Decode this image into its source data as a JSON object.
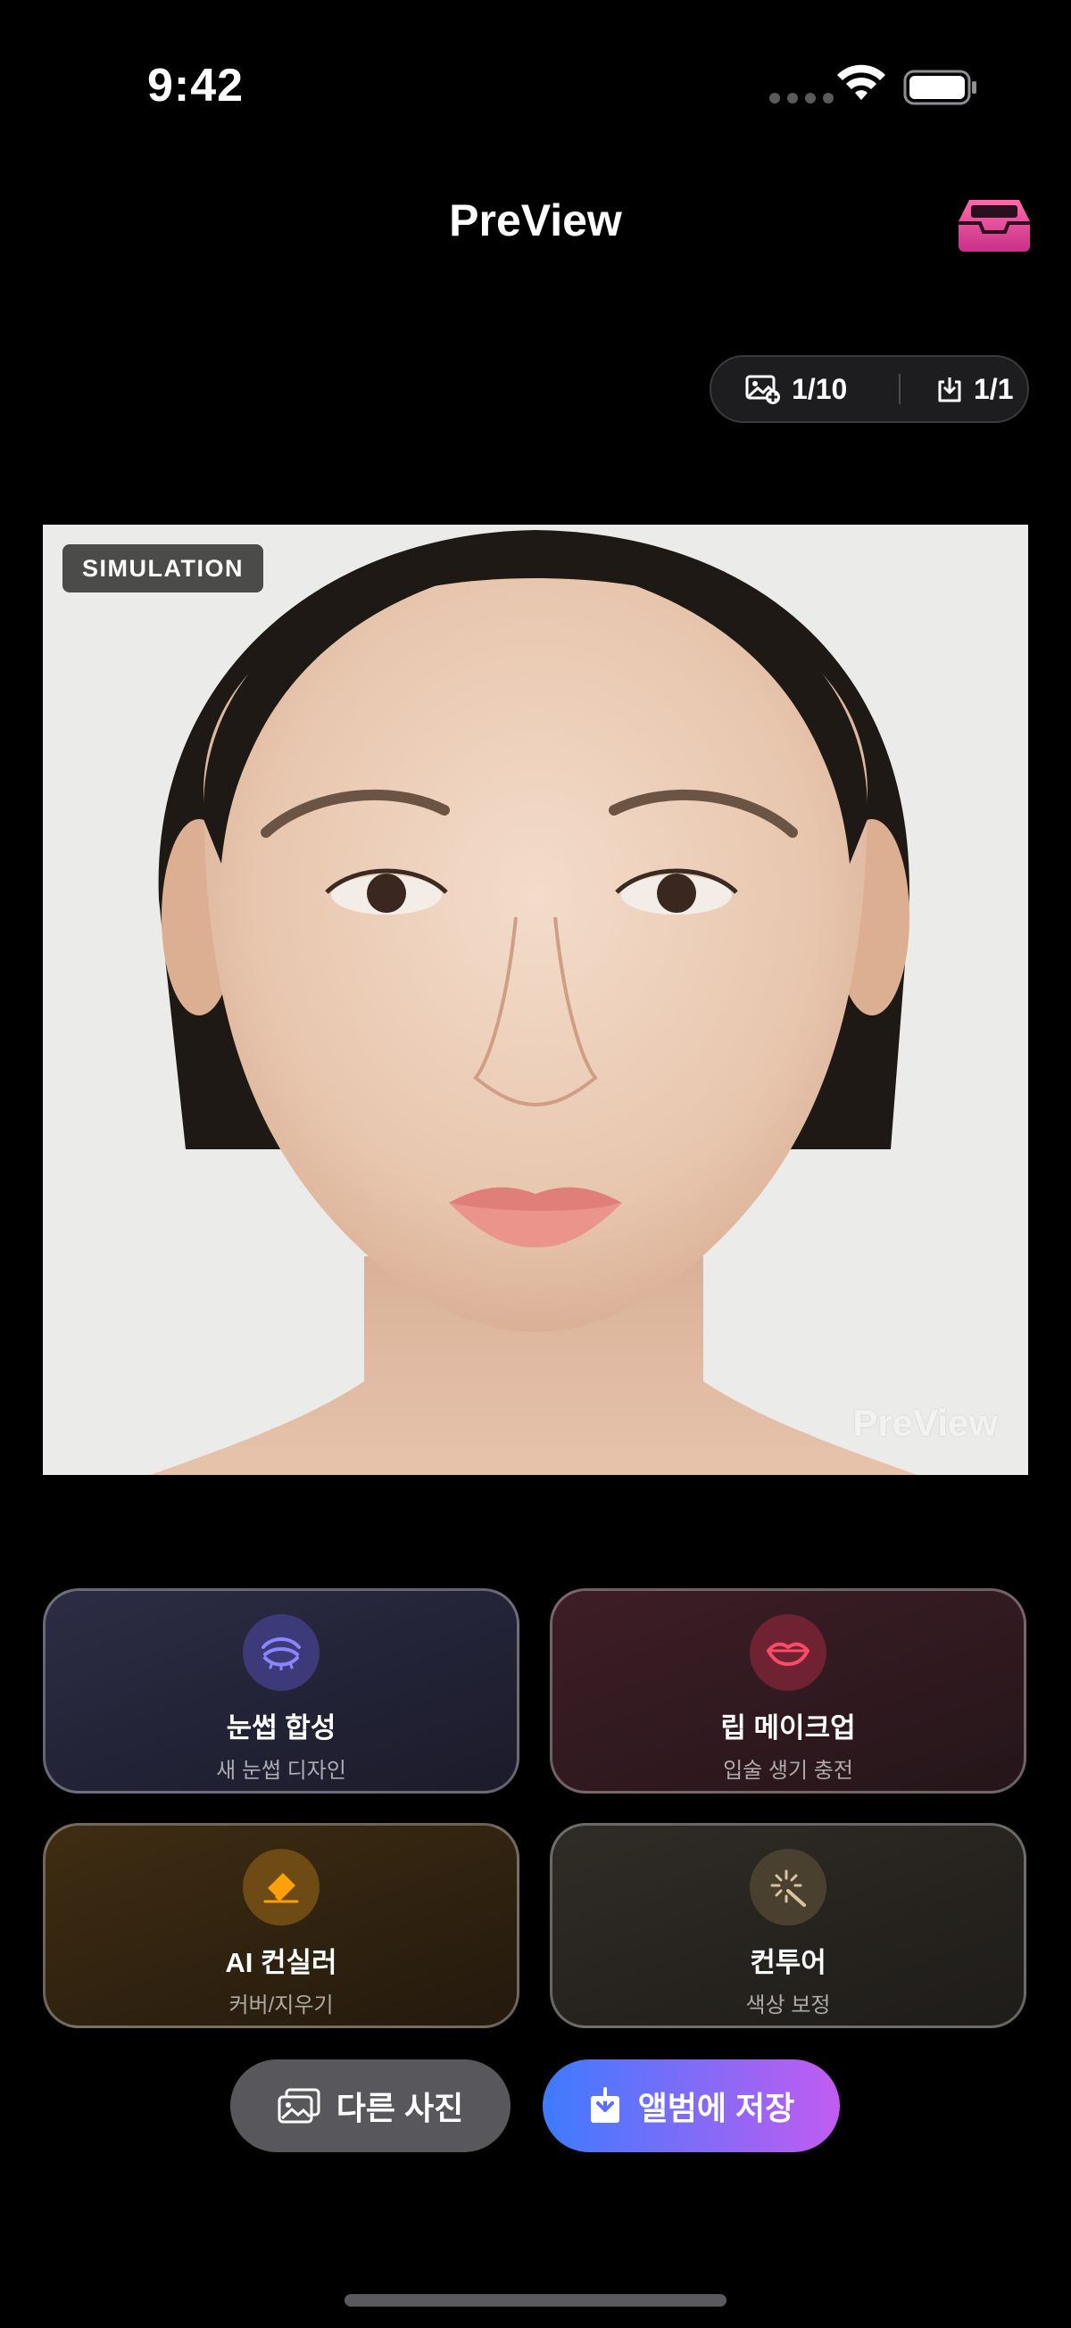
{
  "status_bar": {
    "time": "9:42"
  },
  "header": {
    "title": "PreView",
    "inbox_icon": "inbox-tray-icon"
  },
  "counters": {
    "photos": "1/10",
    "downloads": "1/1"
  },
  "photo": {
    "badge": "SIMULATION",
    "watermark": "PreView"
  },
  "features": [
    {
      "title": "눈썹 합성",
      "subtitle": "새 눈썹 디자인",
      "icon": "eyebrow-icon",
      "color": "#6e6bff"
    },
    {
      "title": "립 메이크업",
      "subtitle": "입술 생기 충전",
      "icon": "lips-icon",
      "color": "#ff3b5c"
    },
    {
      "title": "AI 컨실러",
      "subtitle": "커버/지우기",
      "icon": "eraser-icon",
      "color": "#ff9f0a"
    },
    {
      "title": "컨투어",
      "subtitle": "색상 보정",
      "icon": "magic-wand-icon",
      "color": "#d9c4a0"
    }
  ],
  "actions": {
    "other_photo": "다른 사진",
    "save_album": "앨범에 저장"
  },
  "colors": {
    "accent_gradient_start": "#3d7bff",
    "accent_gradient_end": "#c15cf0",
    "inbox": "#f0509a"
  }
}
